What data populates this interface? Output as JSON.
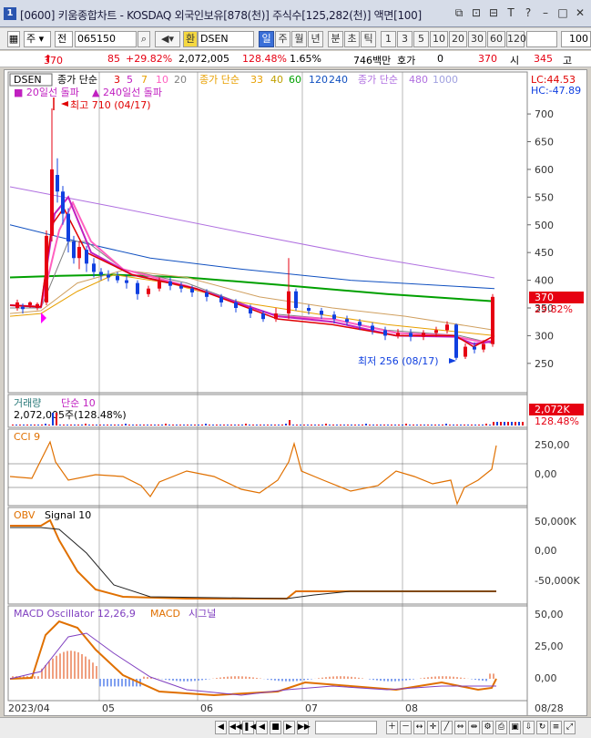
{
  "window": {
    "app_number": "1",
    "title": "[0600] 키움종합차트 - KOSDAQ 외국인보유[878(천)] 주식수[125,282(천)] 액면[100]"
  },
  "toolbar": {
    "period": "주",
    "stock_type": "전",
    "code": "065150",
    "name_search": "환",
    "stock_name": "DSEN",
    "timeframes": [
      "일",
      "주",
      "월",
      "년",
      "분",
      "초",
      "틱"
    ],
    "active_timeframe": "일",
    "minute_options": [
      "1",
      "3",
      "5",
      "10",
      "20",
      "30",
      "60",
      "120"
    ],
    "count": "100"
  },
  "quote": {
    "price": "370",
    "change": "85",
    "change_pct": "+29.82%",
    "volume": "2,072,005",
    "volume_ratio": "128.48%",
    "turnover": "1.65%",
    "amount": "746백만",
    "hoga_label": "호가",
    "hoga_value": "0",
    "ask": "370",
    "open_label": "시",
    "open_value": "345",
    "high_label": "고"
  },
  "price_panel": {
    "stock_label": "DSEN",
    "ma_label": "종가 단순",
    "ma_periods": [
      "3",
      "5",
      "7",
      "10",
      "20"
    ],
    "ma2_label": "종가 단순",
    "ma2_periods": [
      "33",
      "40",
      "60",
      "120",
      "240"
    ],
    "ma3_label": "종가 단순",
    "ma3_periods": [
      "480",
      "1000"
    ],
    "signal1": "20일선 돌파",
    "signal2": "240일선 돌파",
    "high_note": "최고 710 (04/17)",
    "low_note": "최저 256 (08/17)",
    "lc": "LC:44.53",
    "hc": "HC:-47.89",
    "current_price": "370",
    "current_pct": "29.82%",
    "y_ticks": [
      "700",
      "650",
      "600",
      "550",
      "500",
      "450",
      "400",
      "350",
      "300",
      "250"
    ]
  },
  "volume_panel": {
    "label": "거래량",
    "ma_label": "단순 10",
    "value_text": "2,072,005주(128.48%)",
    "current": "2,072K",
    "current_pct": "128.48%"
  },
  "cci_panel": {
    "label": "CCI 9",
    "y_ticks": [
      "250,00",
      "0,00"
    ]
  },
  "obv_panel": {
    "label": "OBV",
    "signal": "Signal 10",
    "y_ticks": [
      "50,000K",
      "0,00",
      "-50,000K"
    ]
  },
  "macd_panel": {
    "label": "MACD Oscillator 12,26,9",
    "macd": "MACD",
    "signal": "시그널",
    "y_ticks": [
      "50,00",
      "25,00",
      "0,00"
    ]
  },
  "x_axis": {
    "labels": [
      "2023/04",
      "05",
      "06",
      "07",
      "08",
      "08/28"
    ]
  },
  "colors": {
    "up": "#e60012",
    "down": "#1040e0",
    "ma3": "#e00000",
    "ma5": "#c020c0",
    "ma7": "#e8a000",
    "ma10": "#ff60c0",
    "ma20": "#808080",
    "ma60": "#00a000",
    "ma120": "#1050c0",
    "ma240": "#b070e0",
    "cci": "#e07000",
    "obv": "#e07000",
    "macd": "#e07000",
    "macd_signal": "#8040c0"
  }
}
